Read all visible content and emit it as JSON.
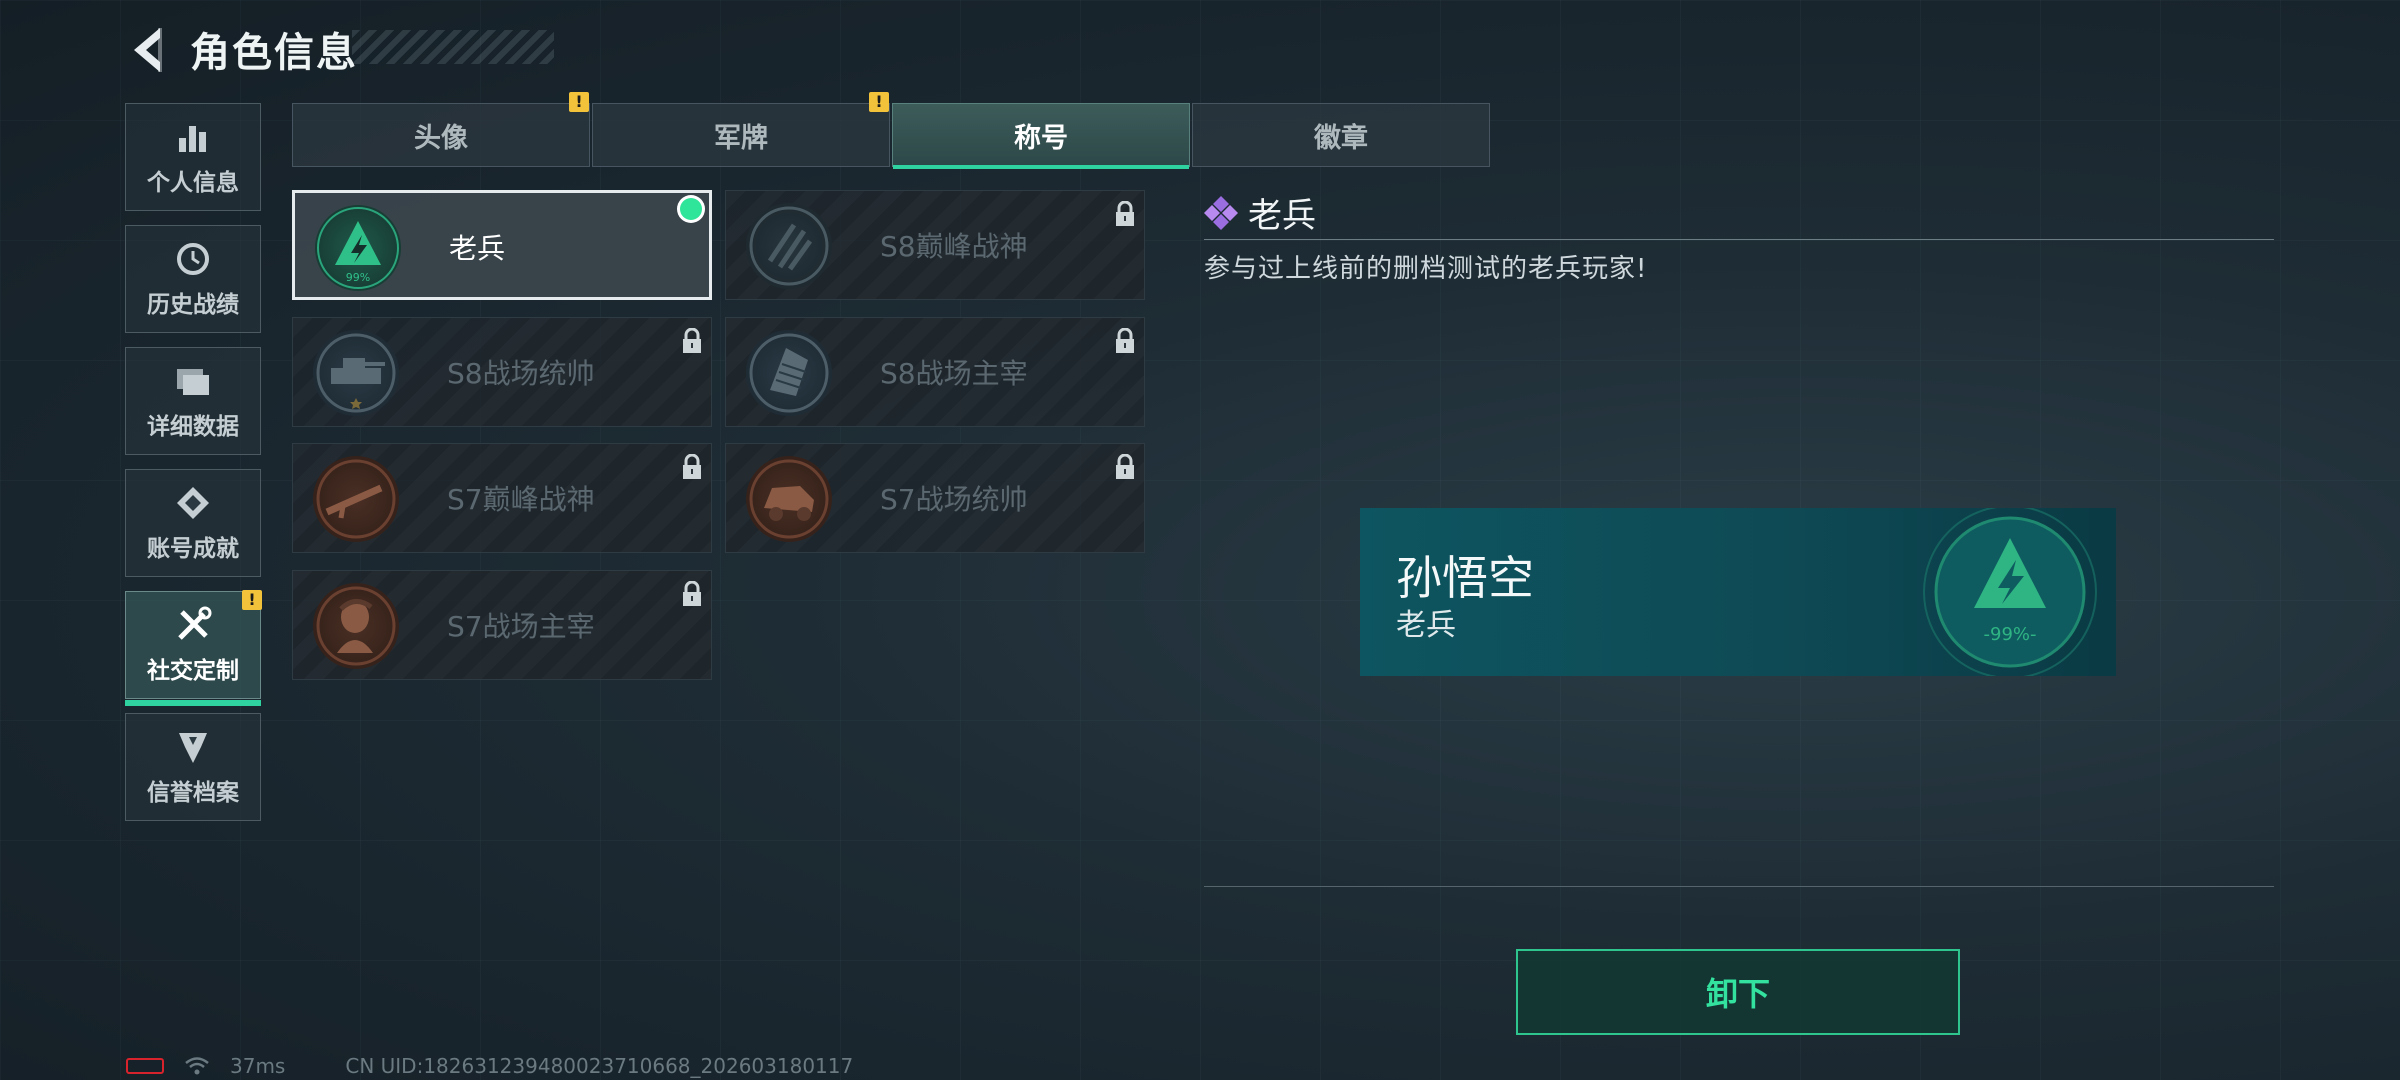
{
  "header": {
    "title": "角色信息"
  },
  "sidebar": {
    "items": [
      {
        "label": "个人信息",
        "icon": "bar-chart-icon"
      },
      {
        "label": "历史战绩",
        "icon": "history-icon"
      },
      {
        "label": "详细数据",
        "icon": "folder-icon"
      },
      {
        "label": "账号成就",
        "icon": "achievement-icon"
      },
      {
        "label": "社交定制",
        "icon": "tools-icon",
        "active": true,
        "badge": "!"
      },
      {
        "label": "信誉档案",
        "icon": "credit-icon"
      }
    ]
  },
  "tabs": [
    {
      "label": "头像",
      "badge": "!"
    },
    {
      "label": "军牌",
      "badge": "!"
    },
    {
      "label": "称号",
      "active": true
    },
    {
      "label": "徽章"
    }
  ],
  "titles": [
    {
      "name": "老兵",
      "selected": true,
      "locked": false,
      "emblem_text": "99%"
    },
    {
      "name": "S8巅峰战神",
      "locked": true
    },
    {
      "name": "S8战场统帅",
      "locked": true
    },
    {
      "name": "S8战场主宰",
      "locked": true
    },
    {
      "name": "S7巅峰战神",
      "locked": true
    },
    {
      "name": "S7战场统帅",
      "locked": true
    },
    {
      "name": "S7战场主宰",
      "locked": true
    }
  ],
  "detail": {
    "title": "老兵",
    "description": "参与过上线前的删档测试的老兵玩家!"
  },
  "preview": {
    "player_name": "孙悟空",
    "title": "老兵",
    "emblem_text": "-99%-"
  },
  "unequip_label": "卸下",
  "footer": {
    "ping": "37ms",
    "uid": "CN UID:182631239480023710668_202603180117"
  },
  "colors": {
    "accent": "#2ed3a0",
    "badge": "#f2c23a",
    "preview_bg": "#0d5560"
  }
}
